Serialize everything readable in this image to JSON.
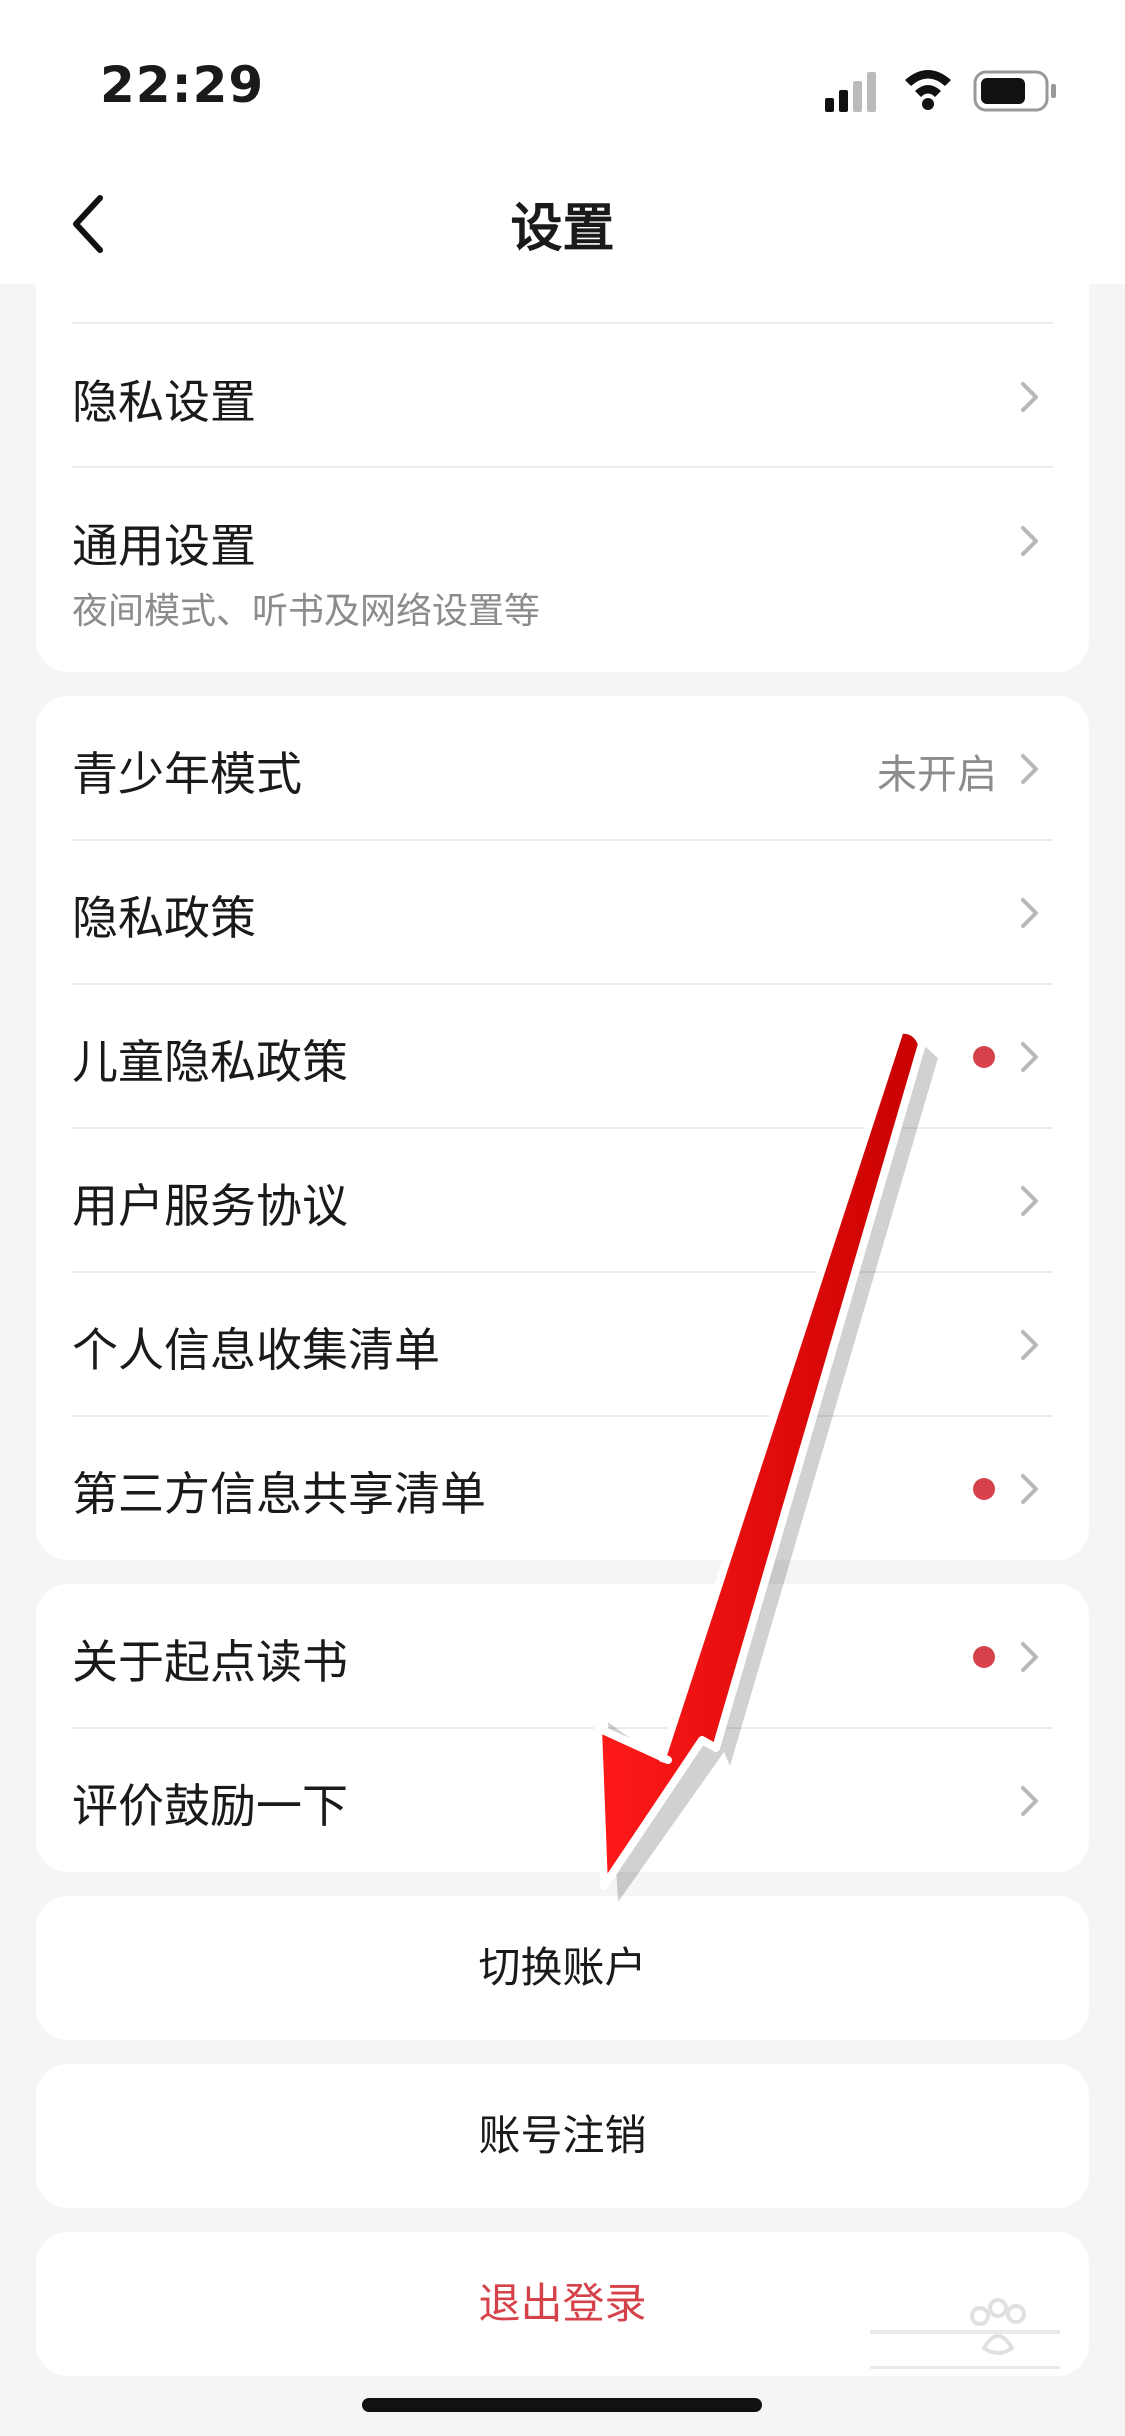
{
  "status_bar": {
    "time": "22:29"
  },
  "nav": {
    "title": "设置"
  },
  "sections": {
    "privacy_settings": "隐私设置",
    "general_settings": {
      "label": "通用设置",
      "subtitle": "夜间模式、听书及网络设置等"
    },
    "youth_mode": {
      "label": "青少年模式",
      "value": "未开启"
    },
    "privacy_policy": "隐私政策",
    "child_privacy_policy": "儿童隐私政策",
    "user_agreement": "用户服务协议",
    "personal_info_list": "个人信息收集清单",
    "third_party_list": "第三方信息共享清单",
    "about": "关于起点读书",
    "rate": "评价鼓励一下"
  },
  "actions": {
    "switch_account": "切换账户",
    "cancel_account": "账号注销",
    "logout": "退出登录"
  },
  "colors": {
    "accent_red": "#d6424a",
    "badge_dot": "#d6424a",
    "annotation_arrow": "#ff0000"
  }
}
